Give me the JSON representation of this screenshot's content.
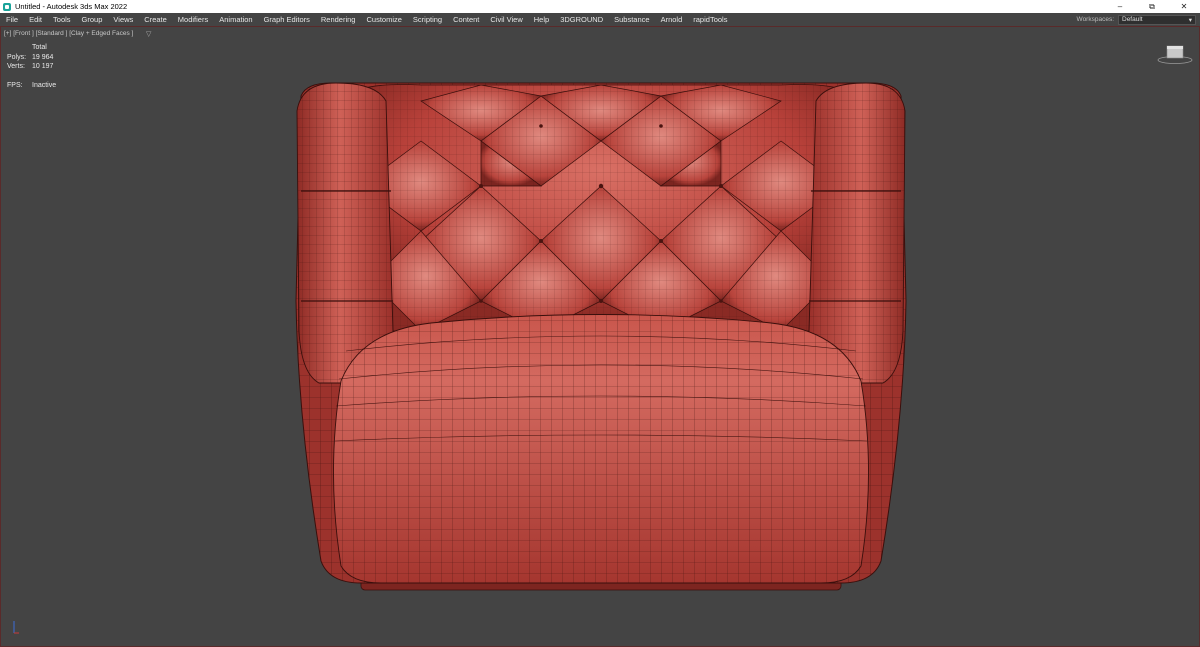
{
  "window": {
    "title": "Untitled - Autodesk 3ds Max 2022",
    "minimize_glyph": "–",
    "restore_glyph": "⧉",
    "close_glyph": "✕"
  },
  "menu": {
    "items": [
      "File",
      "Edit",
      "Tools",
      "Group",
      "Views",
      "Create",
      "Modifiers",
      "Animation",
      "Graph Editors",
      "Rendering",
      "Customize",
      "Scripting",
      "Content",
      "Civil View",
      "Help",
      "3DGROUND",
      "Substance",
      "Arnold",
      "rapidTools"
    ],
    "workspaces_label": "Workspaces:",
    "workspace_value": "Default"
  },
  "viewport": {
    "label": "[+] [Front ] [Standard ] [Clay + Edged Faces ]",
    "stats": {
      "total_label": "Total",
      "polys_label": "Polys:",
      "polys_value": "19 964",
      "verts_label": "Verts:",
      "verts_value": "10 197",
      "fps_label": "FPS:",
      "fps_value": "Inactive"
    }
  },
  "colors": {
    "app_bg": "#444444",
    "clay": "#b8413a",
    "clay_light": "#d6685e",
    "clay_dark": "#7a2420",
    "wire": "#3a0f0c"
  },
  "icons": {
    "app": "3ds-max-app-icon",
    "filter": "filter-icon",
    "viewcube": "viewcube-icon",
    "axis": "axis-tripod-icon"
  }
}
